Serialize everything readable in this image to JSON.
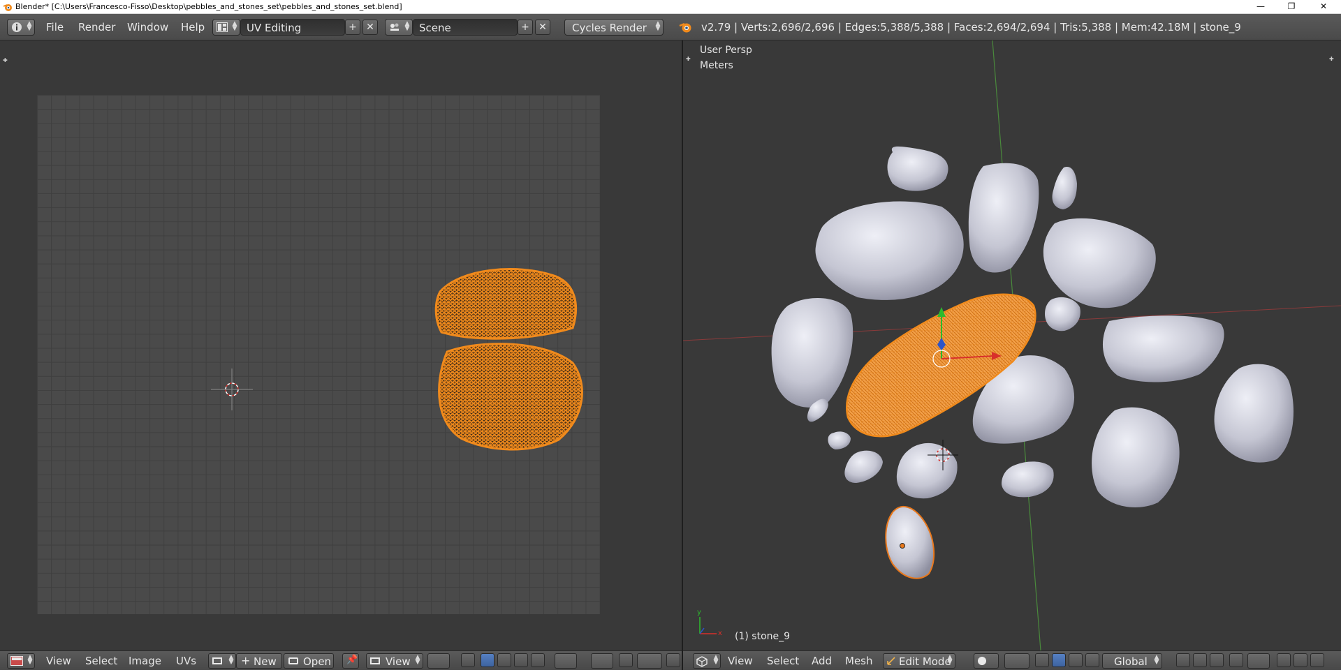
{
  "window": {
    "title": "Blender* [C:\\Users\\Francesco-Fisso\\Desktop\\pebbles_and_stones_set\\pebbles_and_stones_set.blend]",
    "minimize": "—",
    "maximize": "❐",
    "close": "✕"
  },
  "info_header": {
    "menu": [
      "File",
      "Render",
      "Window",
      "Help"
    ],
    "layout": "UV Editing",
    "scene": "Scene",
    "render_engine": "Cycles Render",
    "stats": "v2.79 | Verts:2,696/2,696 | Edges:5,388/5,388 | Faces:2,694/2,694 | Tris:5,388 | Mem:42.18M | stone_9"
  },
  "viewport": {
    "view_name": "User Persp",
    "units": "Meters",
    "object_label": "(1) stone_9"
  },
  "uv_footer": {
    "menu": [
      "View",
      "Select",
      "Image",
      "UVs"
    ],
    "new_label": "New",
    "open_label": "Open",
    "view_label": "View"
  },
  "view3d_footer": {
    "menu": [
      "View",
      "Select",
      "Add",
      "Mesh"
    ],
    "mode": "Edit Mode",
    "orientation": "Global"
  },
  "colors": {
    "selected_mesh": "#f08a1c",
    "stone": "#c8c9d6",
    "background": "#393939",
    "header": "#4e4e4e"
  },
  "icons": [
    "info-icon",
    "screen-layout-icon",
    "scene-icon",
    "blender-logo-icon",
    "add-icon",
    "close-icon",
    "image-editor-icon",
    "pin-icon",
    "view3d-icon",
    "manipulator-icon"
  ]
}
